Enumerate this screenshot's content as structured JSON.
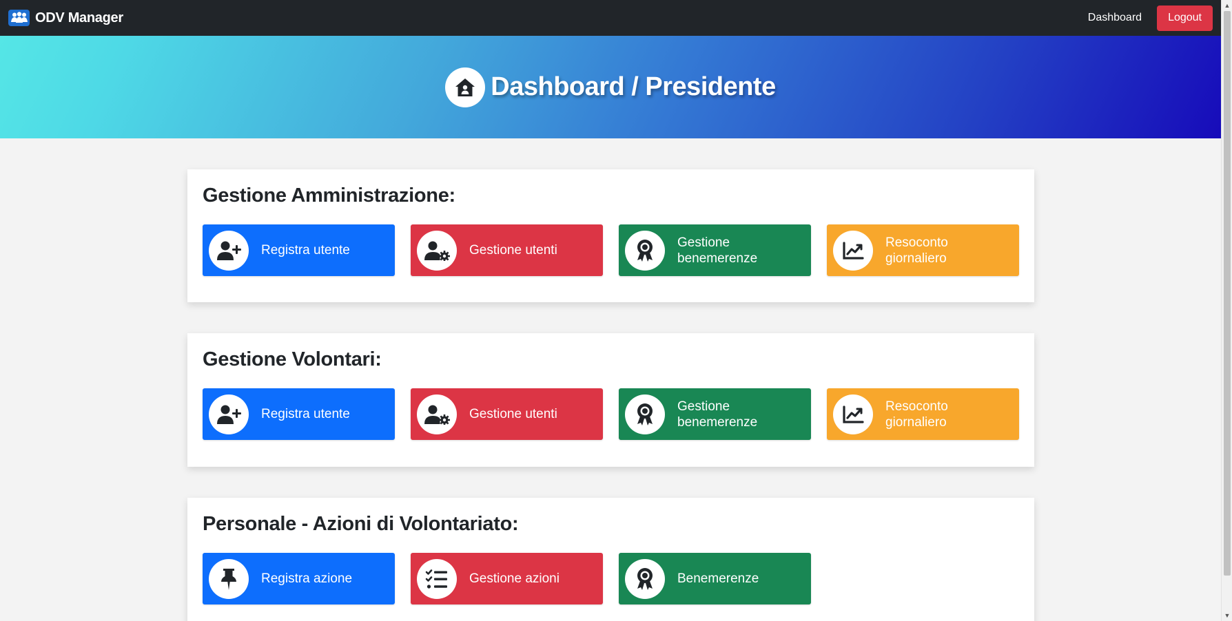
{
  "nav": {
    "brand": "ODV Manager",
    "dashboard_link": "Dashboard",
    "logout": "Logout"
  },
  "hero": {
    "title": "Dashboard / Presidente"
  },
  "sections": [
    {
      "title": "Gestione Amministrazione:",
      "tiles": [
        {
          "label": "Registra utente",
          "icon": "user-plus-icon",
          "color": "#0d6efd"
        },
        {
          "label": "Gestione utenti",
          "icon": "user-gear-icon",
          "color": "#dc3545"
        },
        {
          "label": "Gestione benemerenze",
          "icon": "award-icon",
          "color": "#198754"
        },
        {
          "label": "Resoconto giornaliero",
          "icon": "chart-line-icon",
          "color": "#f8a72c"
        }
      ]
    },
    {
      "title": "Gestione Volontari:",
      "tiles": [
        {
          "label": "Registra utente",
          "icon": "user-plus-icon",
          "color": "#0d6efd"
        },
        {
          "label": "Gestione utenti",
          "icon": "user-gear-icon",
          "color": "#dc3545"
        },
        {
          "label": "Gestione benemerenze",
          "icon": "award-icon",
          "color": "#198754"
        },
        {
          "label": "Resoconto giornaliero",
          "icon": "chart-line-icon",
          "color": "#f8a72c"
        }
      ]
    },
    {
      "title": "Personale - Azioni di Volontariato:",
      "tiles": [
        {
          "label": "Registra azione",
          "icon": "thumbtack-icon",
          "color": "#0d6efd"
        },
        {
          "label": "Gestione azioni",
          "icon": "list-check-icon",
          "color": "#dc3545"
        },
        {
          "label": "Benemerenze",
          "icon": "award-icon",
          "color": "#198754"
        }
      ]
    }
  ]
}
